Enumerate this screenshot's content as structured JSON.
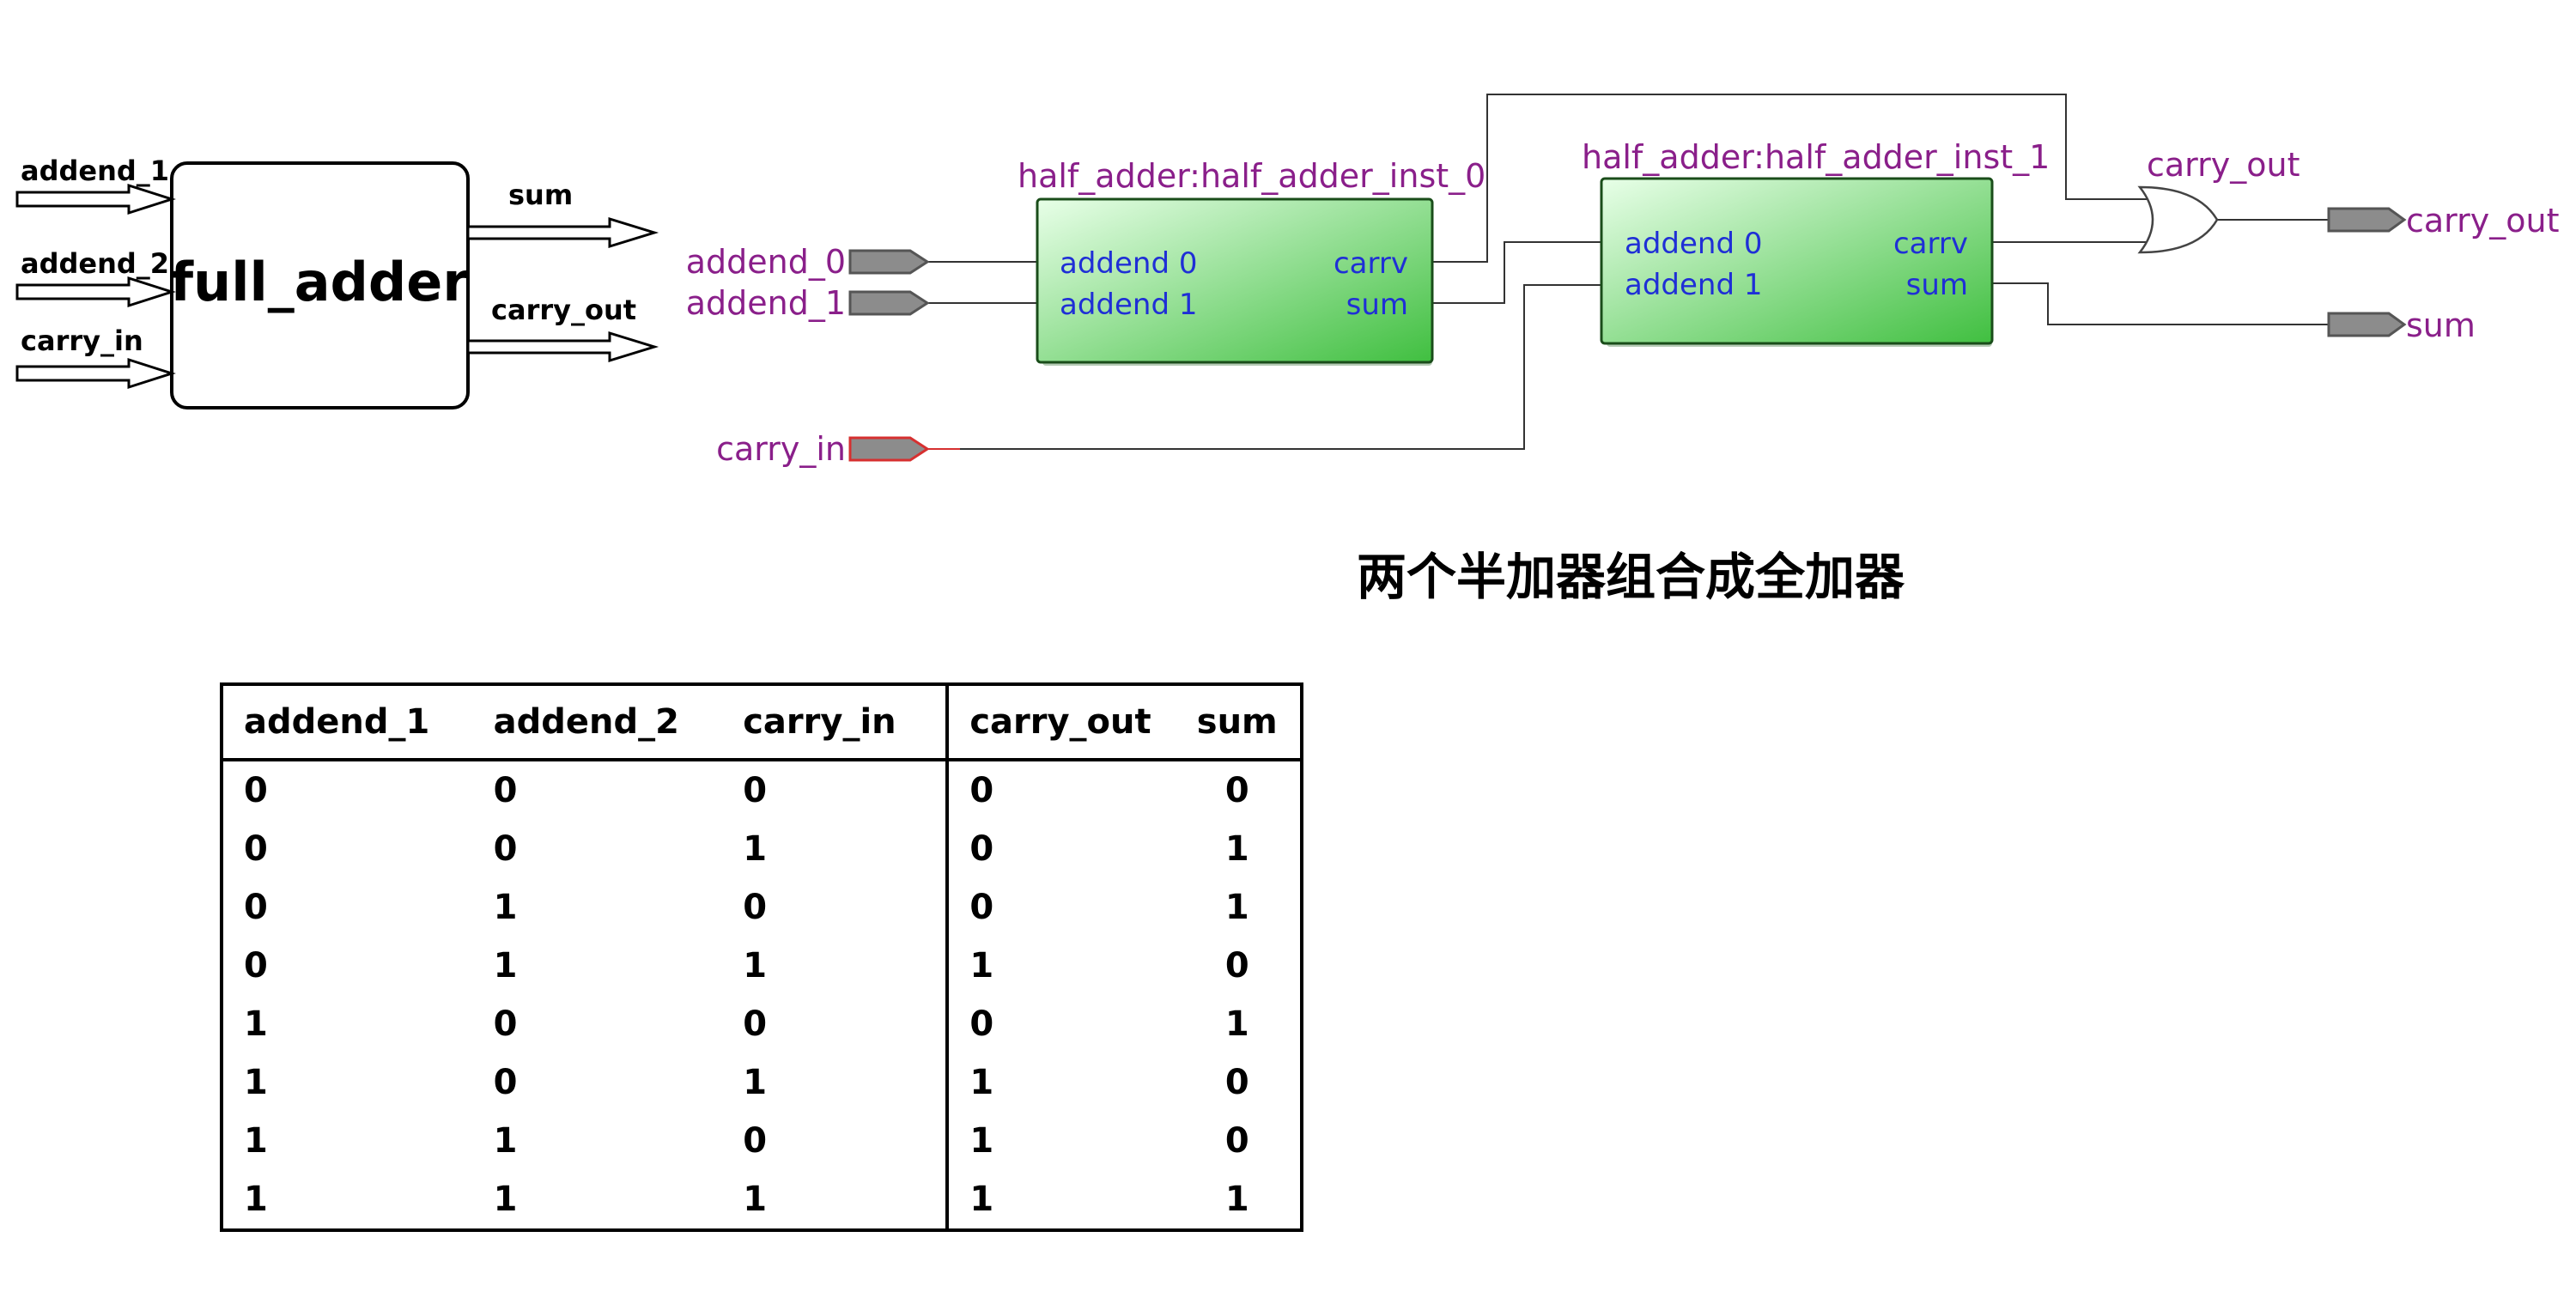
{
  "block": {
    "title": "full_adder",
    "inputs": [
      "addend_1",
      "addend_2",
      "carry_in"
    ],
    "outputs": [
      "sum",
      "carry_out"
    ]
  },
  "schematic": {
    "instances": [
      {
        "name": "half_adder:half_adder_inst_0",
        "ports_in": [
          "addend 0",
          "addend 1"
        ],
        "ports_out": [
          "carrv",
          "sum"
        ]
      },
      {
        "name": "half_adder:half_adder_inst_1",
        "ports_in": [
          "addend 0",
          "addend 1"
        ],
        "ports_out": [
          "carrv",
          "sum"
        ]
      }
    ],
    "input_pins": [
      "addend_0",
      "addend_1",
      "carry_in"
    ],
    "or_gate_label": "carry_out",
    "output_pins": [
      "carry_out",
      "sum"
    ]
  },
  "caption": "两个半加器组合成全加器",
  "truth_table": {
    "headers": [
      "addend_1",
      "addend_2",
      "carry_in",
      "carry_out",
      "sum"
    ],
    "rows": [
      [
        "0",
        "0",
        "0",
        "0",
        "0"
      ],
      [
        "0",
        "0",
        "1",
        "0",
        "1"
      ],
      [
        "0",
        "1",
        "0",
        "0",
        "1"
      ],
      [
        "0",
        "1",
        "1",
        "1",
        "0"
      ],
      [
        "1",
        "0",
        "0",
        "0",
        "1"
      ],
      [
        "1",
        "0",
        "1",
        "1",
        "0"
      ],
      [
        "1",
        "1",
        "0",
        "1",
        "0"
      ],
      [
        "1",
        "1",
        "1",
        "1",
        "1"
      ]
    ]
  },
  "colors": {
    "label_purple": "#8a1f8a",
    "port_blue": "#1f2fd6",
    "block_green_light": "#e6ffe6",
    "block_green_dark": "#44c044",
    "pin_gray": "#8c8c8c",
    "carry_in_pin_border": "#d63030"
  }
}
